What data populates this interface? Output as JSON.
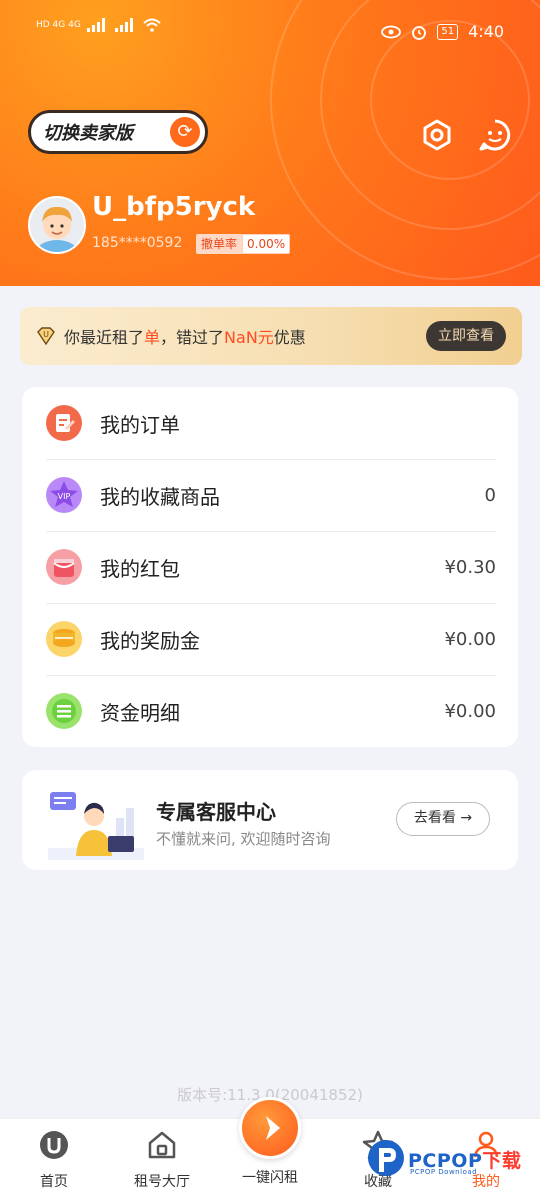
{
  "status_bar": {
    "network_left": "HD 4G 4G",
    "battery": "51",
    "time": "4:40"
  },
  "header": {
    "switch_label": "切换卖家版",
    "username": "U_bfp5ryck",
    "phone": "185****0592",
    "rate_label": "撤单率",
    "rate_value": "0.00%",
    "icons": [
      "settings-icon",
      "customer-service-icon",
      "refresh-icon"
    ]
  },
  "promo": {
    "prefix": "你最近租了",
    "highlight1": "单",
    "middle": "，错过了",
    "highlight2": "NaN元",
    "suffix": "优惠",
    "button": "立即查看"
  },
  "menu": [
    {
      "label": "我的订单",
      "value": "",
      "icon": "order-icon",
      "color": "#f26a4a"
    },
    {
      "label": "我的收藏商品",
      "value": "0",
      "icon": "vip-star-icon",
      "color": "#9b5cf0"
    },
    {
      "label": "我的红包",
      "value": "¥0.30",
      "icon": "red-packet-icon",
      "color": "#f0606b"
    },
    {
      "label": "我的奖励金",
      "value": "¥0.00",
      "icon": "coins-icon",
      "color": "#f3b529"
    },
    {
      "label": "资金明细",
      "value": "¥0.00",
      "icon": "fund-detail-icon",
      "color": "#6cd13f"
    }
  ],
  "service": {
    "title": "专属客服中心",
    "subtitle": "不懂就来问, 欢迎随时咨询",
    "button": "去看看 →"
  },
  "version": "版本号:11.3.0(20041852)",
  "tabs": [
    {
      "label": "首页",
      "icon": "home-u-icon"
    },
    {
      "label": "租号大厅",
      "icon": "hall-icon"
    },
    {
      "label": "一键闪租",
      "icon": "flash-rent-icon"
    },
    {
      "label": "收藏",
      "icon": "star-icon"
    },
    {
      "label": "我的",
      "icon": "profile-icon"
    }
  ],
  "watermark": {
    "big": "PCPOP",
    "dl": "下载",
    "small": "PCPOP Download"
  },
  "colors": {
    "accent": "#ff6a1a",
    "active_tab": "#ff5a1c"
  }
}
